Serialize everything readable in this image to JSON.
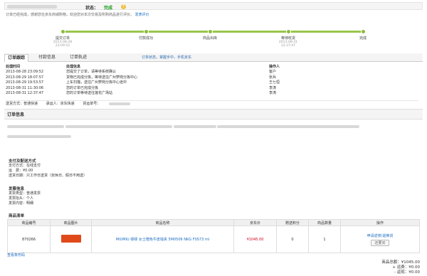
{
  "header": {
    "status_label": "状态：",
    "status_value": "完成",
    "help_icon": "question-icon"
  },
  "notice": {
    "text": "订单已经完成，感谢您在京东商城购物，欢迎您对本次交易及所购商品进行评价。",
    "link": "发表评价"
  },
  "progress": {
    "steps": [
      {
        "label": "提交订单",
        "time1": "2013-08-28",
        "time2": "23:09:52"
      },
      {
        "label": "付款成功",
        "time1": "",
        "time2": ""
      },
      {
        "label": "商品出库",
        "time1": "",
        "time2": ""
      },
      {
        "label": "等待收货",
        "time1": "2013-08-31",
        "time2": "12:37:47"
      },
      {
        "label": "完成",
        "time1": "",
        "time2": ""
      }
    ]
  },
  "tabs": {
    "items": [
      "订单跟踪",
      "付款信息",
      "订单轨迹"
    ],
    "link": "订单状态，掌握手中，手机京东"
  },
  "tracking": {
    "headers": [
      "处理时间",
      "处理信息",
      "操作人"
    ],
    "rows": [
      [
        "2013-08-28 23:09:52",
        "您提交了订单，请等待系统确认",
        "客户"
      ],
      [
        "2013-08-29 18:07:57",
        "货物已完成分拣，等待送往广州萝岗分拣中心",
        "张兵"
      ],
      [
        "2013-08-29 19:53:57",
        "上车扫描，送往广州萝岗分拣中心途中",
        "王七恒"
      ],
      [
        "2013-08-31 11:30:06",
        "您的订单已完成分拣",
        "李涛"
      ],
      [
        "2013-08-31 12:37:47",
        "您的订单等待送往莲花广场站",
        "李涛"
      ]
    ],
    "ship_method": "送货方式：普通快递",
    "carrier": "承运人：京东快递",
    "tracking_no": "货运单号："
  },
  "order_info": {
    "title": "订单信息",
    "payment_title": "支付及配送方式",
    "payment_lines": [
      "支付方式：在线支付",
      "运　费：¥0.00",
      "送货日期：只工作日送货（双休日、假日不用送）"
    ],
    "invoice_title": "发票信息",
    "invoice_lines": [
      "发票类型：普通发票",
      "发票抬头：个人",
      "发票内容：明细"
    ],
    "list_title": "商品清单"
  },
  "products": {
    "headers": [
      "商品编号",
      "商品图片",
      "商品名称",
      "京东价",
      "赠送积分",
      "商品数量",
      "操作"
    ],
    "rows": [
      {
        "id": "870266",
        "name": "MIUMIU 缪缪 女士橙色牛皮钱夹 5M0506 NKG F0S73 ml",
        "price": "¥1045.00",
        "points": "0",
        "qty": "1",
        "op_link": "申请返修/退换货",
        "op_btn": "还要买"
      }
    ]
  },
  "view_code": "查看条形码",
  "totals": {
    "goods": "商品总额：¥1045.00",
    "shipping": "+ 运费：¥0.00",
    "refund": "- 返现：¥0.00"
  },
  "colors": {
    "progress": "#8cbc3c",
    "status_green": "#1a9a1a",
    "link_blue": "#1a6bc0",
    "price_red": "#d0021b"
  }
}
